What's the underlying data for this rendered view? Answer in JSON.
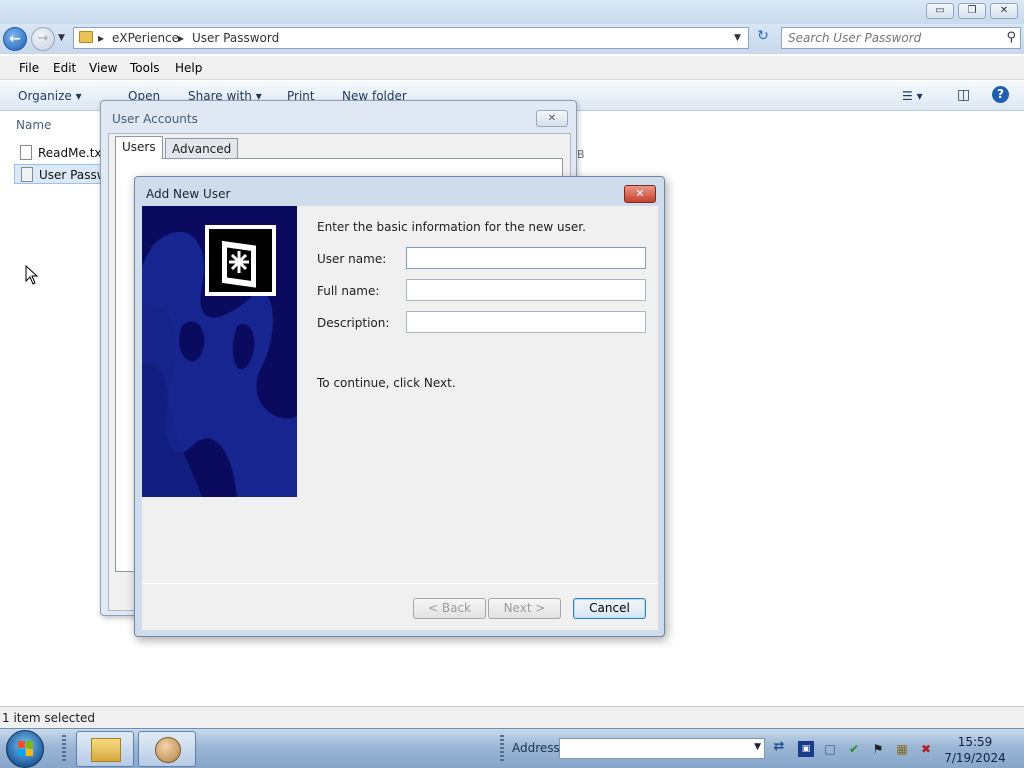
{
  "window": {
    "controls": {
      "minimize": "▭",
      "maximize": "❐",
      "close": "✕"
    }
  },
  "navigation": {
    "breadcrumb": [
      "eXPerience",
      "User Password"
    ],
    "search_placeholder": "Search User Password"
  },
  "menubar": {
    "items": [
      "File",
      "Edit",
      "View",
      "Tools",
      "Help"
    ]
  },
  "toolbar": {
    "items": [
      "Organize",
      "Open",
      "Share with",
      "Print",
      "New folder"
    ]
  },
  "filelist": {
    "column_header": "Name",
    "files": [
      "ReadMe.txt",
      "User Password"
    ]
  },
  "statusbar": {
    "text": "1 item selected"
  },
  "user_accounts_dialog": {
    "title": "User Accounts",
    "tabs": [
      "Users",
      "Advanced"
    ],
    "side_letter": "B"
  },
  "add_user_dialog": {
    "title": "Add New User",
    "intro": "Enter the basic information for the new user.",
    "fields": [
      {
        "label": "User name:",
        "value": ""
      },
      {
        "label": "Full name:",
        "value": ""
      },
      {
        "label": "Description:",
        "value": ""
      }
    ],
    "continue_text": "To continue, click Next.",
    "buttons": {
      "back": "< Back",
      "next": "Next >",
      "cancel": "Cancel"
    },
    "banner_color": "#0a0a5e"
  },
  "taskbar": {
    "address_label": "Address",
    "clock_time": "15:59",
    "clock_date": "7/19/2024"
  },
  "icons": {
    "back": "back-arrow-icon",
    "forward": "forward-arrow-icon",
    "search": "search-icon",
    "refresh": "refresh-icon",
    "folder": "folder-icon",
    "key": "key-icon",
    "start": "windows-start-icon"
  }
}
